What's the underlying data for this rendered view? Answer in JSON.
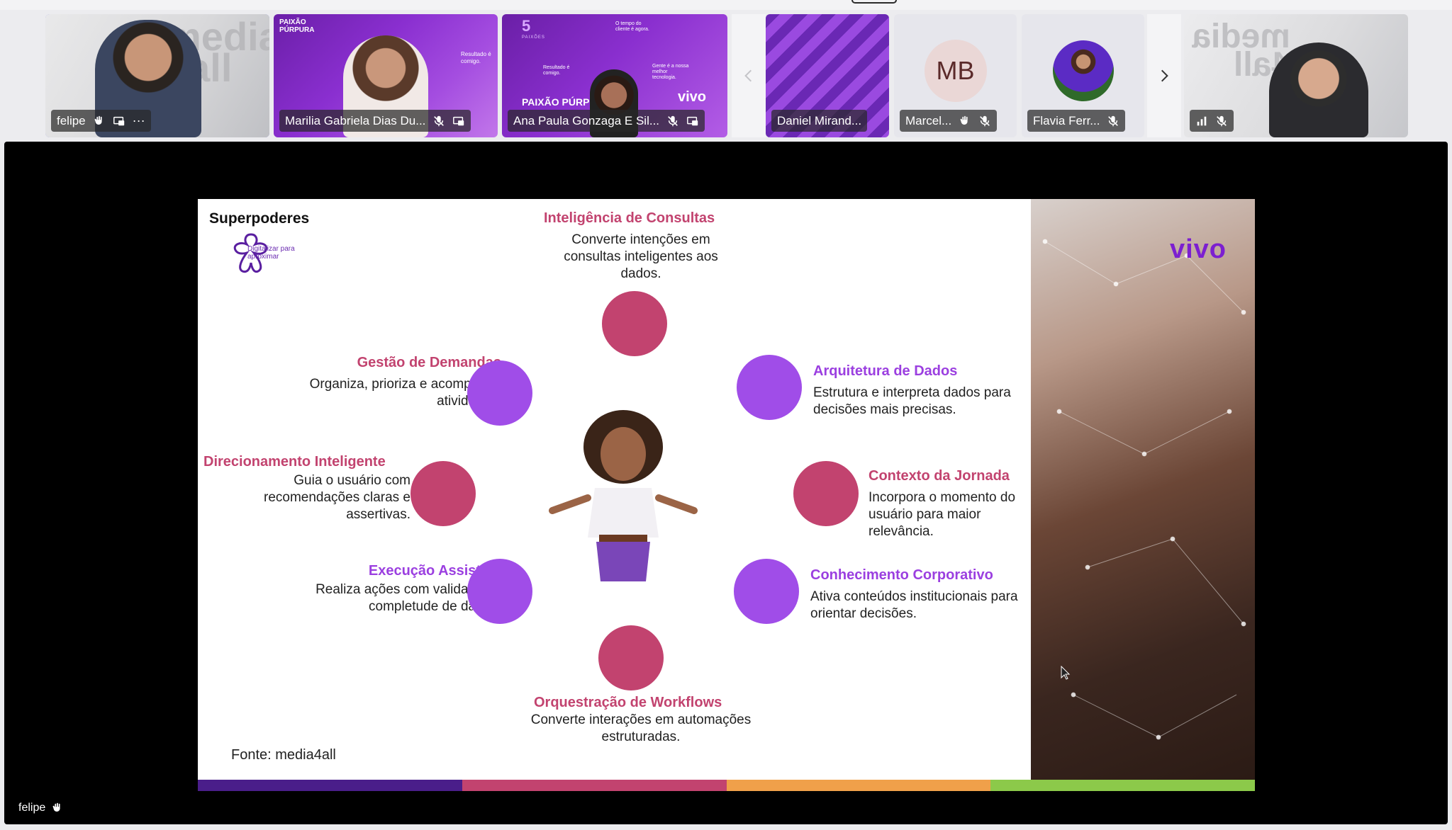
{
  "participants": [
    {
      "name": "felipe",
      "active": true,
      "icons": [
        "raised-hand-icon",
        "screen-share-icon",
        "more-options-icon"
      ]
    },
    {
      "name": "Marilia Gabriela Dias Du...",
      "icons": [
        "mic-off-icon",
        "screen-share-icon"
      ]
    },
    {
      "name": "Ana Paula Gonzaga E Sil...",
      "icons": [
        "mic-off-icon",
        "screen-share-icon"
      ]
    },
    {
      "name": "Daniel Mirand..."
    },
    {
      "name": "Marcel...",
      "initials": "MB",
      "icons": [
        "raised-hand-icon",
        "mic-off-icon"
      ]
    },
    {
      "name": "Flavia Ferr...",
      "icons": [
        "mic-off-icon"
      ]
    },
    {
      "name": "",
      "icons": [
        "signal-icon",
        "mic-off-icon"
      ]
    }
  ],
  "tile_text": {
    "marilia_brand": "PAIXÃO PÚRPURA",
    "marilia_badge": "Resultado é comigo.",
    "ana_number": "5",
    "ana_number_caption": "PAIXÕES",
    "ana_brand": "PAIXÃO PÚRPU",
    "ana_vivo": "vivo",
    "ana_caption_1": "O tempo do cliente é agora.",
    "ana_caption_2": "Gente é a nossa melhor tecnologia.",
    "ana_caption_3": "Resultado é comigo.",
    "felipe_bg": "media 4all",
    "last_bg": "media 4all"
  },
  "slide": {
    "title": "Superpoderes",
    "brand_tag": "Digitalizar para aproximar",
    "vivo": "vivo",
    "source": "Fonte: media4all",
    "powers": {
      "consultas": {
        "title": "Inteligência de Consultas",
        "desc": "Converte intenções em consultas inteligentes aos dados."
      },
      "demandas": {
        "title": "Gestão de Demandas",
        "desc": "Organiza, prioriza e acompanha atividades."
      },
      "arquitetura": {
        "title": "Arquitetura de Dados",
        "desc": "Estrutura e interpreta dados para decisões mais precisas."
      },
      "direcionamento": {
        "title": "Direcionamento Inteligente",
        "desc": "Guia o usuário com recomendações claras e assertivas."
      },
      "jornada": {
        "title": "Contexto da Jornada",
        "desc": "Incorpora o momento do usuário para maior relevância."
      },
      "execucao": {
        "title": "Execução Assistida",
        "desc": "Realiza ações com validação e completude de dados."
      },
      "conhecimento": {
        "title": "Conhecimento Corporativo",
        "desc": "Ativa conteúdos institucionais para orientar decisões."
      },
      "workflows": {
        "title": "Orquestração de Workflows",
        "desc": "Converte interações em automações estruturadas."
      }
    },
    "colors": {
      "pink": "#c2436f",
      "purple": "#a04de8",
      "stripe": [
        "#4a1e8a",
        "#c2436f",
        "#f0a04a",
        "#8cc94a"
      ]
    }
  },
  "presenter_label": "felipe"
}
